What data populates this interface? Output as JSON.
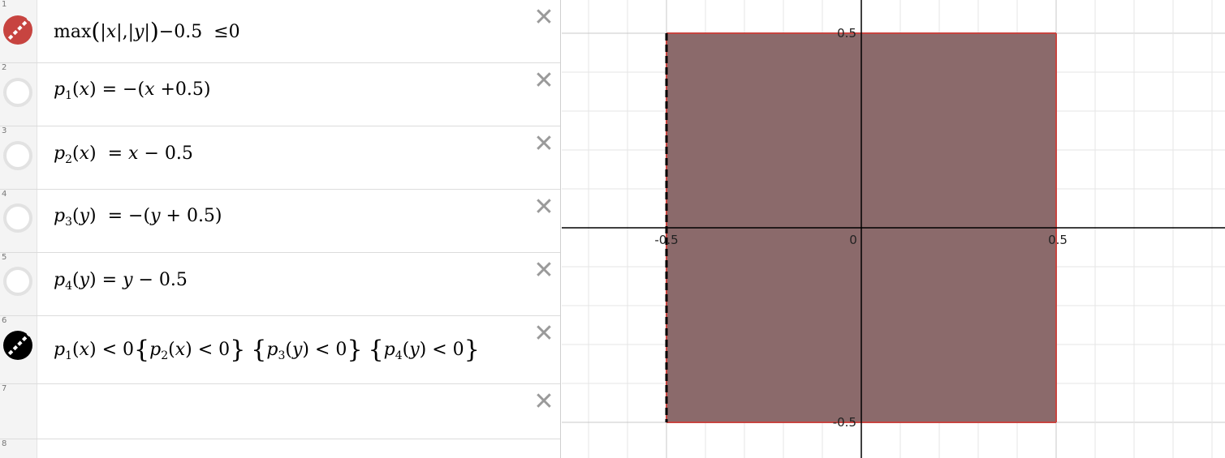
{
  "expressions": [
    {
      "num": "1",
      "dot": "red-dashed",
      "tex": "max",
      "closable": true
    },
    {
      "num": "2",
      "dot": "empty",
      "closable": true
    },
    {
      "num": "3",
      "dot": "empty",
      "closable": true
    },
    {
      "num": "4",
      "dot": "empty",
      "closable": true
    },
    {
      "num": "5",
      "dot": "empty",
      "closable": true
    },
    {
      "num": "6",
      "dot": "black-dashed",
      "closable": true
    },
    {
      "num": "7",
      "dot": "none",
      "closable": true
    },
    {
      "num": "8",
      "dot": "none",
      "closable": false
    }
  ],
  "text": {
    "e1": {
      "fn": "max",
      "x": "x",
      "y": "y",
      "rest": "−0.5",
      "rel": "≤",
      "rhs": "0"
    },
    "e2": {
      "name": "p",
      "sub": "1",
      "arg": "x",
      "rhs_pre": "= −(",
      "rhs_var": "x",
      "rhs_post": "+0.5)"
    },
    "e3": {
      "name": "p",
      "sub": "2",
      "arg": "x",
      "rhs_pre": "=",
      "rhs_var": "x",
      "rhs_post": "− 0.5"
    },
    "e4": {
      "name": "p",
      "sub": "3",
      "arg": "y",
      "rhs_pre": "= −(",
      "rhs_var": "y",
      "rhs_post": "+ 0.5)"
    },
    "e5": {
      "name": "p",
      "sub": "4",
      "arg": "y",
      "rhs_pre": "=",
      "rhs_var": "y",
      "rhs_post": "− 0.5"
    },
    "e6": {
      "p": "p",
      "s1": "1",
      "s2": "2",
      "s3": "3",
      "s4": "4",
      "x": "x",
      "y": "y",
      "lt": "< 0"
    }
  },
  "close_glyph": "✕",
  "graph": {
    "tick_labels": {
      "x_neg": "-0.5",
      "origin": "0",
      "x_pos": "0.5",
      "y_pos": "0.5",
      "y_neg": "-0.5"
    },
    "region": {
      "xmin": -0.5,
      "xmax": 0.5,
      "ymin": -0.5,
      "ymax": 0.5
    },
    "colors": {
      "fill": "#8b6a6b",
      "border": "#c74440",
      "left_edge": "#000000",
      "axis": "#000000",
      "grid": "#e6e6e6",
      "major_grid": "#c8c8c8"
    }
  }
}
